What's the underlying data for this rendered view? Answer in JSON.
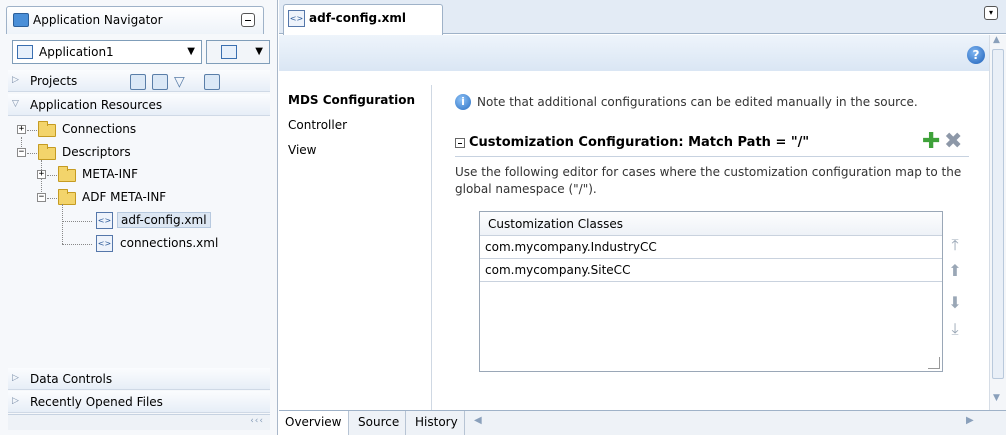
{
  "navigator": {
    "tab_label": "Application Navigator",
    "application": "Application1",
    "projects_label": "Projects",
    "app_resources_label": "Application Resources",
    "tree": {
      "connections": "Connections",
      "descriptors": "Descriptors",
      "meta_inf": "META-INF",
      "adf_meta_inf": "ADF META-INF",
      "adf_config": "adf-config.xml",
      "connections_xml": "connections.xml"
    },
    "data_controls_label": "Data Controls",
    "recent_files_label": "Recently Opened Files"
  },
  "editor": {
    "tab_label": "adf-config.xml",
    "categories": [
      "MDS Configuration",
      "Controller",
      "View"
    ],
    "note": "Note that additional configurations can be edited manually in the source.",
    "section_title": "Customization Configuration: Match Path = \"/\"",
    "description": "Use the following editor for cases where the customization configuration map to the global namespace (\"/\").",
    "table": {
      "header": "Customization Classes",
      "rows": [
        "com.mycompany.IndustryCC",
        "com.mycompany.SiteCC"
      ]
    },
    "bottom_tabs": [
      "Overview",
      "Source",
      "History"
    ]
  },
  "colors": {
    "accent": "#1d5fb8",
    "add": "#3fa23a",
    "delete": "#8d98a8"
  },
  "icons": [
    "application-navigator-icon",
    "help-icon",
    "info-icon",
    "add-icon",
    "delete-icon",
    "folder-icon",
    "xml-file-icon"
  ]
}
